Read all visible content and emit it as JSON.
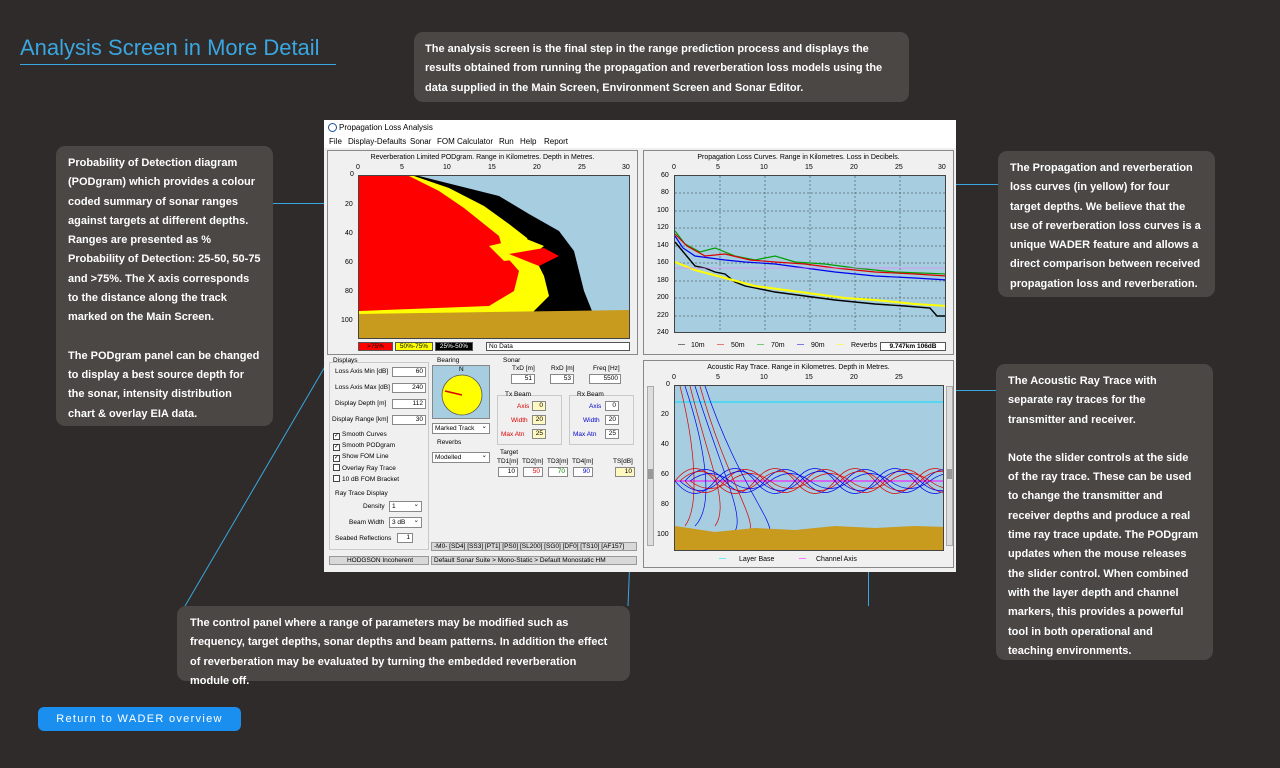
{
  "page_title": "Analysis Screen in More Detail",
  "callouts": {
    "top": "The analysis screen is the final step in the range prediction process and displays the results obtained from running the propagation and reverberation loss models using the data supplied in the Main Screen, Environment Screen and Sonar Editor.",
    "left_p1": "Probability of Detection diagram (PODgram) which provides a colour coded summary of sonar ranges against targets at different depths. Ranges are presented as % Probability of Detection: 25-50, 50-75 and >75%. The X axis corresponds to the distance along the track marked on the Main Screen.",
    "left_p2": "The PODgram panel can be changed to display a best source depth for the sonar, intensity distribution chart & overlay EIA data.",
    "right_top": "The Propagation and reverberation loss curves (in yellow) for four target depths. We believe that the use of reverberation loss curves is a unique WADER feature and allows a direct comparison between received propagation loss and reverberation.",
    "right_bottom_p1": "The Acoustic Ray Trace with separate ray traces for the transmitter and receiver.",
    "right_bottom_p2": "Note the slider controls at the side of the ray trace. These can be used to change the transmitter and receiver depths and produce a real time ray trace update. The PODgram updates when the mouse releases the slider control. When combined with the layer depth and channel markers, this provides a powerful tool in both operational and teaching environments.",
    "bottom": "The control panel where a range of parameters may be modified such as frequency, target depths, sonar depths and beam patterns. In addition the effect of reverberation may be evaluated by turning the embedded reverberation module off."
  },
  "return_button": "Return to WADER overview",
  "window": {
    "title": "Propagation Loss Analysis",
    "controls": {
      "displays_title": "Displays",
      "loss_min_label": "Loss Axis Min [dB]",
      "loss_min": "60",
      "loss_max_label": "Loss Axis Max [dB]",
      "loss_max": "240",
      "disp_depth_label": "Display Depth [m]",
      "disp_depth": "112",
      "disp_range_label": "Display Range [km]",
      "disp_range": "30",
      "checkboxes": [
        {
          "label": "Smooth Curves",
          "checked": true
        },
        {
          "label": "Smooth PODgram",
          "checked": true
        },
        {
          "label": "Show FOM Line",
          "checked": true
        },
        {
          "label": "Overlay Ray Trace",
          "checked": false
        },
        {
          "label": "10 dB FOM Bracket",
          "checked": false
        }
      ],
      "ray_trace_title": "Ray Trace Display",
      "density_label": "Density",
      "density": "1",
      "beam_width_label": "Beam Width",
      "beam_width": "3 dB",
      "seabed_label": "Seabed Reflections",
      "seabed": "1",
      "bearing_title": "Bearing",
      "bearing_n": "N",
      "bearing_select": "Marked Track",
      "reverbs_title": "Reverbs",
      "reverbs_select": "Modelled",
      "sonar_title": "Sonar",
      "txd_label": "TxD [m]",
      "txd": "51",
      "rxd_label": "RxD [m]",
      "rxd": "53",
      "freq_label": "Freq [Hz]",
      "freq": "5500",
      "tx_beam": "Tx Beam",
      "rx_beam": "Rx Beam",
      "axis_label": "Axis",
      "width_label": "Width",
      "maxatn_label": "Max Atn",
      "tx_axis": "0",
      "tx_width": "20",
      "tx_maxatn": "25",
      "rx_axis": "0",
      "rx_width": "20",
      "rx_maxatn": "25",
      "target_title": "Target",
      "td_labels": [
        "TD1[m]",
        "TD2[m]",
        "TD3[m]",
        "TD4[m]",
        "TS[dB]"
      ],
      "td_values": [
        "10",
        "50",
        "70",
        "90",
        "10"
      ],
      "status_model": "HODGSON Incoherent",
      "status_codes": "-M0- [SD4] [SS3] [PT1] [PS0] [SL200] [SG0] [DF0] [TS10] [AF157]",
      "status_sonar": "Default Sonar Suite > Mono-Static > Default Monostatic HM"
    },
    "menu": [
      "File",
      "Display-Defaults",
      "Sonar",
      "FOM Calculator",
      "Run",
      "Help",
      "Report"
    ],
    "podgram": {
      "title": "Reverberation Limited PODgram. Range in Kilometres. Depth in Metres.",
      "x_ticks": [
        "0",
        "5",
        "10",
        "15",
        "20",
        "25",
        "30"
      ],
      "y_ticks": [
        "0",
        "20",
        "40",
        "60",
        "80",
        "100"
      ],
      "legend": [
        ">75%",
        "50%-75%",
        "25%-50%"
      ],
      "legend_colors": [
        "#ff0000",
        "#ffff00",
        "#000000"
      ],
      "no_data": "No Data"
    },
    "prop": {
      "title": "Propagation Loss Curves. Range in Kilometres. Loss in Decibels.",
      "x_ticks": [
        "0",
        "5",
        "10",
        "15",
        "20",
        "25",
        "30"
      ],
      "y_ticks": [
        "60",
        "80",
        "100",
        "120",
        "140",
        "160",
        "180",
        "200",
        "220",
        "240"
      ],
      "legend": [
        "10m",
        "50m",
        "70m",
        "90m",
        "Reverbs"
      ],
      "legend_colors": [
        "#000000",
        "#dd0000",
        "#00a000",
        "#0000ee",
        "#ffff00"
      ],
      "readout": "9.747km 106dB"
    },
    "ray": {
      "title": "Acoustic Ray Trace. Range in Kilometres. Depth in Metres.",
      "x_ticks": [
        "0",
        "5",
        "10",
        "15",
        "20",
        "25"
      ],
      "y_ticks": [
        "0",
        "20",
        "40",
        "60",
        "80",
        "100"
      ],
      "legend": [
        "Layer Base",
        "Channel Axis"
      ],
      "legend_colors": [
        "#00e0ff",
        "#ff00ff"
      ]
    }
  }
}
